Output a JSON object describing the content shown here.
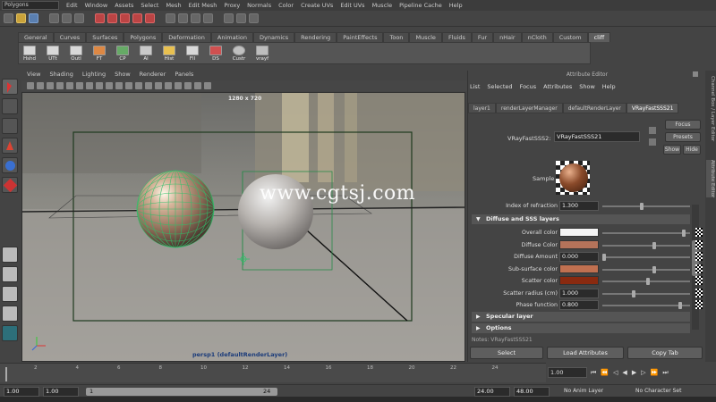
{
  "menubar": {
    "mode": "Polygons",
    "items": [
      "Edit",
      "Window",
      "Assets",
      "Select",
      "Mesh",
      "Edit Mesh",
      "Proxy",
      "Normals",
      "Color",
      "Create UVs",
      "Edit UVs",
      "Muscle",
      "Pipeline Cache",
      "Help"
    ]
  },
  "shelf": {
    "tabs": [
      "General",
      "Curves",
      "Surfaces",
      "Polygons",
      "Deformation",
      "Animation",
      "Dynamics",
      "Rendering",
      "PaintEffects",
      "Toon",
      "Muscle",
      "Fluids",
      "Fur",
      "nHair",
      "nCloth",
      "Custom",
      "cliff"
    ],
    "active_tab": "cliff",
    "buttons": [
      "Hshd",
      "UTt",
      "Outl",
      "FT",
      "CP",
      "Al",
      "Hist",
      "Fll",
      "DS",
      "Custr",
      "vrayf"
    ]
  },
  "panel": {
    "menu": [
      "View",
      "Shading",
      "Lighting",
      "Show",
      "Renderer",
      "Panels"
    ],
    "resolution": "1280 x 720",
    "camera": "persp1 (defaultRenderLayer)"
  },
  "watermark": "www.cgtsj.com",
  "attribute_editor": {
    "title": "Attribute Editor",
    "menu": [
      "List",
      "Selected",
      "Focus",
      "Attributes",
      "Show",
      "Help"
    ],
    "tabs": [
      "layer1",
      "renderLayerManager",
      "defaultRenderLayer",
      "VRayFastSSS21"
    ],
    "active_tab": "VRayFastSSS21",
    "node_label": "VRayFastSSS2:",
    "node_value": "VRayFastSSS21",
    "focus": "Focus",
    "presets": "Presets",
    "show": "Show",
    "hide": "Hide",
    "sample_label": "Sample",
    "index_of_refraction": {
      "label": "Index of refraction",
      "value": "1.300",
      "level": 0.45
    },
    "section_diffuse": "Diffuse and SSS layers",
    "rows": [
      {
        "label": "Overall color",
        "type": "color",
        "color": "#f4f4f4",
        "level": 0.95
      },
      {
        "label": "Diffuse Color",
        "type": "color",
        "color": "#b5735a",
        "level": 0.6
      },
      {
        "label": "Diffuse Amount",
        "type": "value",
        "value": "0.000",
        "level": 0.0
      },
      {
        "label": "Sub-surface color",
        "type": "color",
        "color": "#c07050",
        "level": 0.6
      },
      {
        "label": "Scatter color",
        "type": "color",
        "color": "#8a2a10",
        "level": 0.52
      },
      {
        "label": "Scatter radius (cm)",
        "type": "value",
        "value": "1.000",
        "level": 0.35
      },
      {
        "label": "Phase function",
        "type": "value",
        "value": "0.800",
        "level": 0.9
      }
    ],
    "section_specular": "Specular layer",
    "section_options": "Options",
    "notes": "Notes: VRayFastSSS21",
    "select": "Select",
    "load_attributes": "Load Attributes",
    "copy_tab": "Copy Tab"
  },
  "side_tabs": {
    "channel_box": "Channel Box / Layer Editor",
    "attribute_editor": "Attribute Editor"
  },
  "timeline": {
    "ticks": [
      "2",
      "4",
      "6",
      "8",
      "10",
      "12",
      "14",
      "16",
      "18",
      "20",
      "22",
      "24"
    ],
    "current_frame": "1.00"
  },
  "range": {
    "start": "1.00",
    "inner_start": "1.00",
    "frame": "1",
    "inner_end": "24",
    "end": "24.00",
    "outer_end": "48.00",
    "anim_layer": "No Anim Layer",
    "character_set": "No Character Set"
  }
}
